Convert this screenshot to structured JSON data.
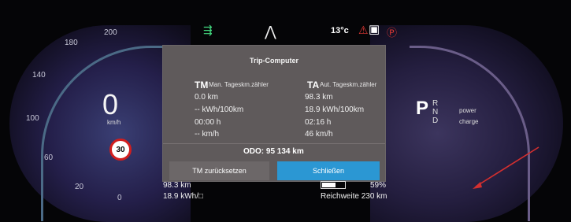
{
  "status_bar": {
    "temperature": "13°c",
    "beam_icon": "beam-icon",
    "road_icon": "road-icon",
    "warning_icon": "seatbelt-icon",
    "parking_icon": "parking-icon"
  },
  "left_gauge": {
    "ticks": [
      "180",
      "200",
      "140",
      "100",
      "60",
      "20",
      "0"
    ],
    "speed": "0",
    "speed_unit": "km/h",
    "speed_limit": "30"
  },
  "right_gauge": {
    "gear": "P",
    "gears": [
      "R",
      "N",
      "D"
    ],
    "power_label": "power",
    "charge_label": "charge"
  },
  "popup": {
    "title": "Trip-Computer",
    "tm_label": "TM",
    "tm_sub": "Man. Tageskm.zähler",
    "ta_label": "TA",
    "ta_sub": "Aut. Tageskm.zähler",
    "tm_values": [
      "0.0 km",
      "-- kWh/100km",
      "00:00 h",
      "-- km/h"
    ],
    "ta_values": [
      "98.3 km",
      "18.9 kWh/100km",
      "02:16 h",
      "46 km/h"
    ],
    "odo": "ODO: 95 134 km",
    "reset_button": "TM zurücksetzen",
    "close_button": "Schließen"
  },
  "bottom": {
    "trip_km": "98.3 km",
    "consumption": "18.9 kWh/□",
    "battery_percent": "59%",
    "battery_level": 0.59,
    "range": "Reichweite 230 km"
  }
}
